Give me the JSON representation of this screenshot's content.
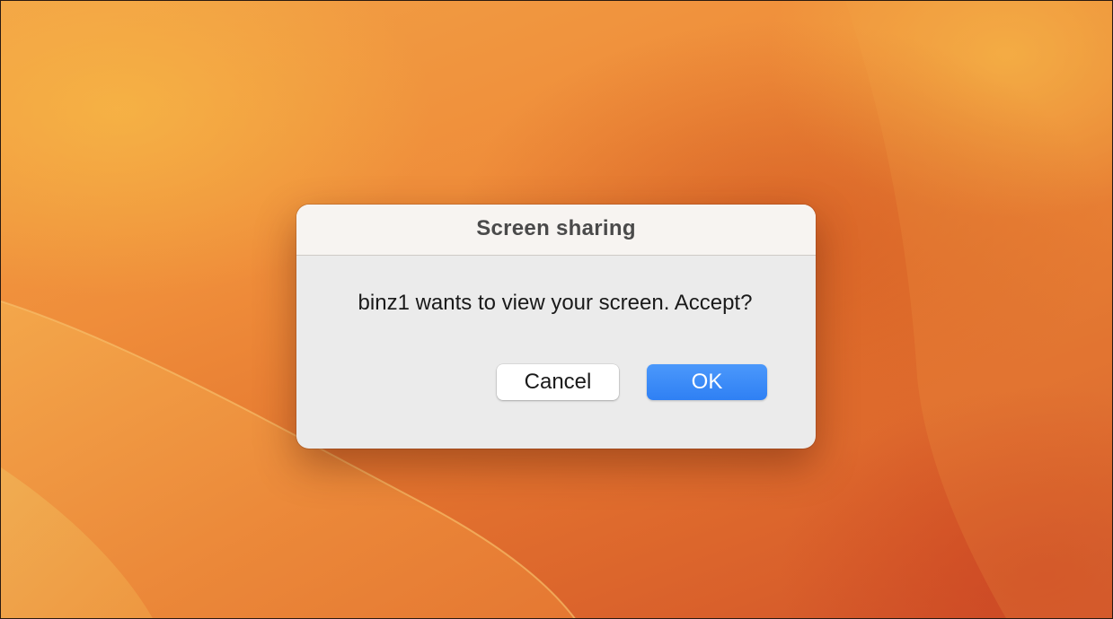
{
  "dialog": {
    "title": "Screen sharing",
    "message": "binz1 wants to view your screen. Accept?",
    "cancel_label": "Cancel",
    "ok_label": "OK"
  },
  "colors": {
    "accent": "#2f80f4",
    "wallpaper_primary": "#ef8d3a",
    "wallpaper_dark": "#d9602b",
    "dialog_background": "#ebebeb"
  }
}
